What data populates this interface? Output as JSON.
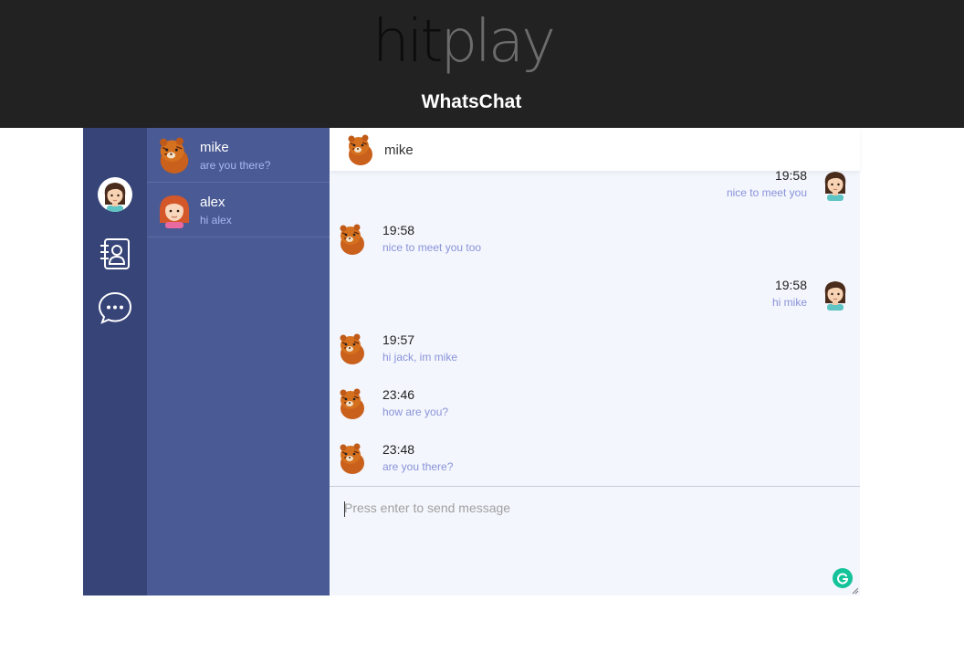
{
  "header": {
    "logo_hit": "hit",
    "logo_play": "play",
    "app_title": "WhatsChat"
  },
  "contacts": [
    {
      "name": "mike",
      "preview": "are you there?",
      "avatar": "tiger-avatar"
    },
    {
      "name": "alex",
      "preview": "hi alex",
      "avatar": "redhead-avatar"
    }
  ],
  "chat": {
    "contact_name": "mike",
    "messages": [
      {
        "side": "right",
        "time": "19:58",
        "text": "nice to meet you"
      },
      {
        "side": "left",
        "time": "19:58",
        "text": "nice to meet you too"
      },
      {
        "side": "right",
        "time": "19:58",
        "text": "hi mike"
      },
      {
        "side": "left",
        "time": "19:57",
        "text": "hi jack, im mike"
      },
      {
        "side": "left",
        "time": "23:46",
        "text": "how are you?"
      },
      {
        "side": "left",
        "time": "23:48",
        "text": "are you there?"
      }
    ],
    "input_placeholder": "Press enter to send message",
    "input_value": ""
  },
  "colors": {
    "topbar": "#222222",
    "rail": "#374478",
    "list": "#4a5a94",
    "chat_bg": "#f4f6fd",
    "message_text": "#8893d9",
    "preview_text": "#a9b7f3",
    "grammarly": "#15c39a"
  },
  "icons": {
    "rail": [
      "user-avatar-icon",
      "contacts-icon",
      "chat-bubble-icon"
    ],
    "composer": [
      "grammarly-icon"
    ]
  }
}
